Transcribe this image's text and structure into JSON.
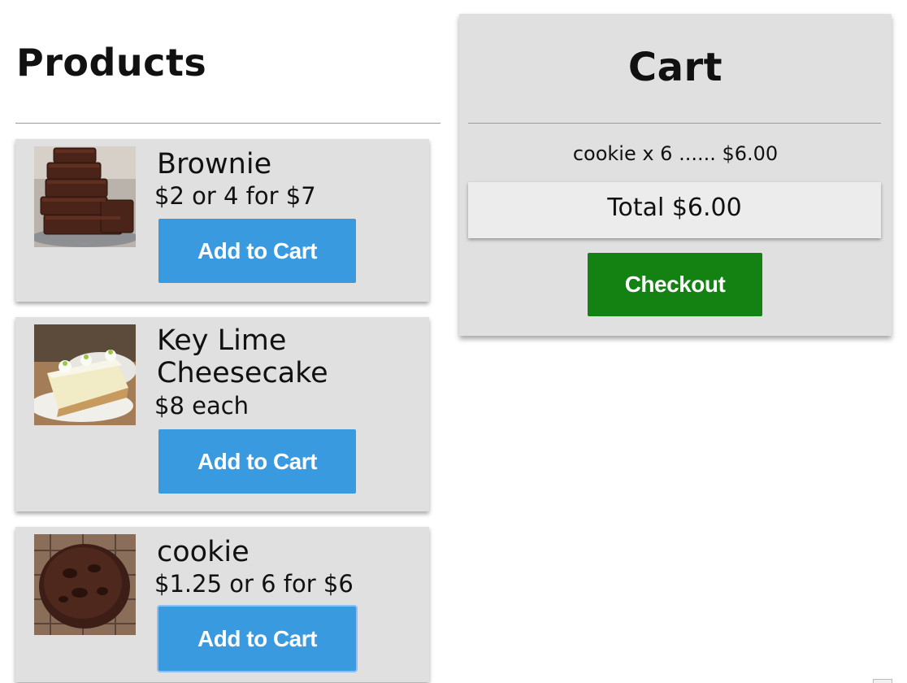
{
  "products": {
    "title": "Products",
    "items": [
      {
        "name": "Brownie",
        "price": "$2 or 4 for $7",
        "button_label": "Add to Cart",
        "image_icon": "brownie-photo"
      },
      {
        "name": "Key Lime Cheesecake",
        "price": "$8 each",
        "button_label": "Add to Cart",
        "image_icon": "cheesecake-photo"
      },
      {
        "name": "cookie",
        "price": "$1.25 or 6 for $6",
        "button_label": "Add to Cart",
        "image_icon": "cookie-photo"
      }
    ]
  },
  "cart": {
    "title": "Cart",
    "items": [
      {
        "line": "cookie x 6 ...... $6.00"
      }
    ],
    "total": "Total $6.00",
    "checkout_label": "Checkout"
  },
  "colors": {
    "card_bg": "#e0e0e0",
    "add_button": "#3a9ae0",
    "checkout_button": "#138213",
    "total_bg": "#ececec"
  }
}
